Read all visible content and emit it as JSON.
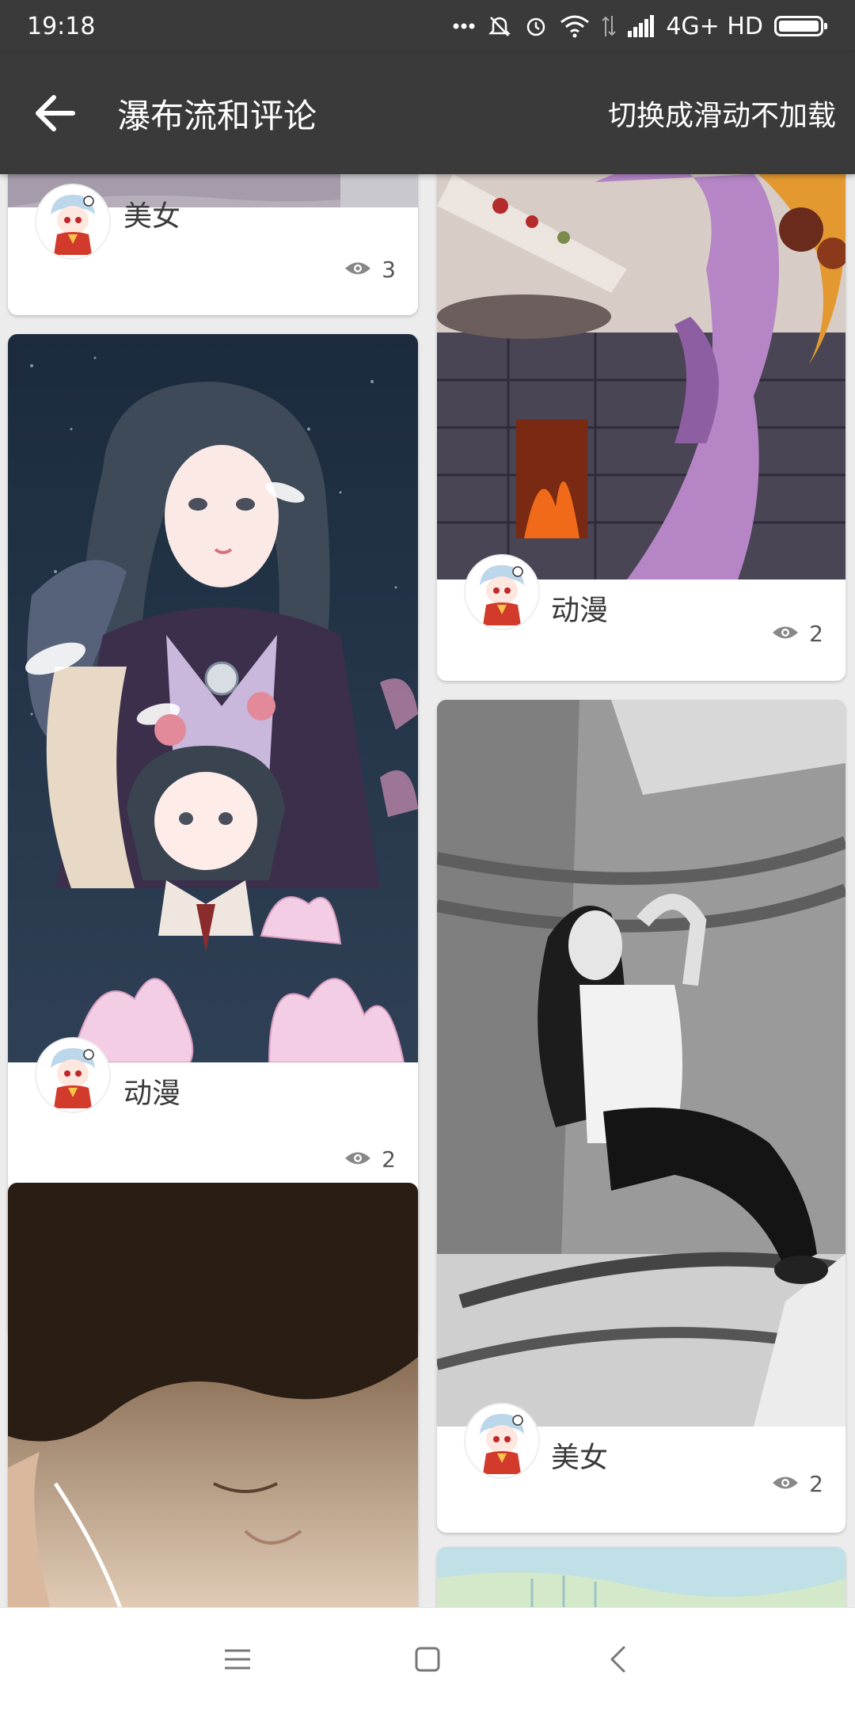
{
  "status_bar": {
    "time": "19:18",
    "network": "4G+ HD",
    "icons": [
      "more-dots-icon",
      "mute-icon",
      "alarm-icon",
      "wifi-icon",
      "data-arrows-icon",
      "signal-icon",
      "battery-icon"
    ]
  },
  "toolbar": {
    "title": "瀑布流和评论",
    "action_label": "切换成滑动不加载",
    "back_icon": "back-arrow-icon"
  },
  "cards": [
    {
      "tag": "美女",
      "views": "3"
    },
    {
      "tag": "动漫",
      "views": "2"
    },
    {
      "tag": "动漫",
      "views": "2"
    },
    {
      "tag": "美女",
      "views": "2"
    }
  ],
  "nav_bar": {
    "icons": [
      "menu-icon",
      "home-icon",
      "back-icon"
    ]
  },
  "colors": {
    "toolbar": "#3a3a3a",
    "background": "#ececec",
    "card": "#ffffff"
  }
}
